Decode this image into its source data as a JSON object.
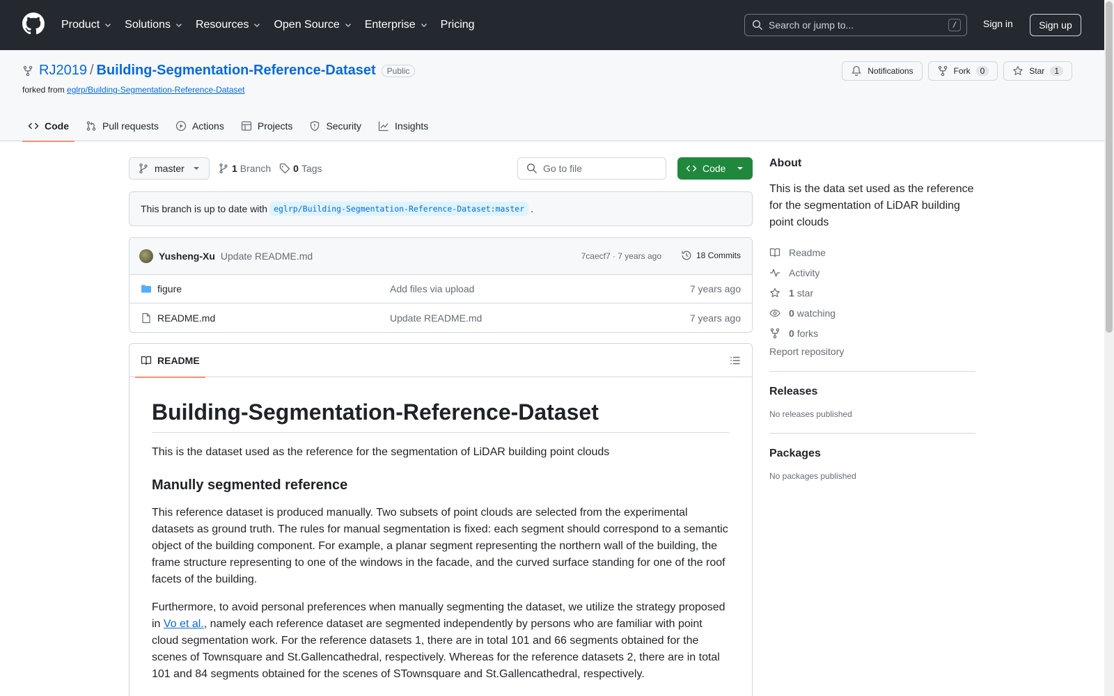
{
  "header": {
    "nav": [
      "Product",
      "Solutions",
      "Resources",
      "Open Source",
      "Enterprise",
      "Pricing"
    ],
    "search_placeholder": "Search or jump to...",
    "search_shortcut": "/",
    "signin": "Sign in",
    "signup": "Sign up"
  },
  "repo": {
    "owner": "RJ2019",
    "separator": "/",
    "name": "Building-Segmentation-Reference-Dataset",
    "visibility": "Public",
    "forked_prefix": "forked from",
    "forked_source": "eglrp/Building-Segmentation-Reference-Dataset",
    "actions": {
      "notifications": "Notifications",
      "fork": "Fork",
      "fork_count": "0",
      "star": "Star",
      "star_count": "1"
    },
    "tabs": [
      "Code",
      "Pull requests",
      "Actions",
      "Projects",
      "Security",
      "Insights"
    ]
  },
  "toolbar": {
    "branch": "master",
    "branch_count": "1",
    "branch_label": "Branch",
    "tag_count": "0",
    "tag_label": "Tags",
    "goto_placeholder": "Go to file",
    "code_label": "Code"
  },
  "uptodate": {
    "text": "This branch is up to date with",
    "ref": "eglrp/Building-Segmentation-Reference-Dataset:master",
    "suffix": "."
  },
  "commit": {
    "author": "Yusheng-Xu",
    "message": "Update README.md",
    "meta": "7caecf7 · 7 years ago",
    "commits": "18 Commits"
  },
  "files": [
    {
      "name": "figure",
      "type": "folder",
      "commit": "Add files via upload",
      "age": "7 years ago"
    },
    {
      "name": "README.md",
      "type": "file",
      "commit": "Update README.md",
      "age": "7 years ago"
    }
  ],
  "readme": {
    "tab": "README",
    "h1": "Building-Segmentation-Reference-Dataset",
    "intro": "This is the dataset used as the reference for the segmentation of LiDAR building point clouds",
    "h2": "Manully segmented reference",
    "p1": "This reference dataset is produced manually. Two subsets of point clouds are selected from the experimental datasets as ground truth. The rules for manual segmentation is fixed: each segment should correspond to a semantic object of the building component. For example, a planar segment representing the northern wall of the building, the frame structure representing to one of the windows in the facade, and the curved surface standing for one of the roof facets of the building.",
    "p2_a": "Furthermore, to avoid personal preferences when manually segmenting the dataset, we utilize the strategy proposed in ",
    "p2_link": "Vo et al.",
    "p2_b": ", namely each reference dataset are segmented independently by persons who are familiar with point cloud segmentation work. For the reference datasets 1, there are in total 101 and 66 segments obtained for the scenes of Townsquare and St.Gallencathedral, respectively. Whereas for the reference datasets 2, there are in total 101 and 84 segments obtained for the scenes of STownsquare and St.Gallencathedral, respectively."
  },
  "sidebar": {
    "about_title": "About",
    "about_desc": "This is the data set used as the reference for the segmentation of LiDAR building point clouds",
    "readme": "Readme",
    "activity": "Activity",
    "stars_count": "1",
    "stars_label": "star",
    "watching_count": "0",
    "watching_label": "watching",
    "forks_count": "0",
    "forks_label": "forks",
    "report": "Report repository",
    "releases_title": "Releases",
    "releases_none": "No releases published",
    "packages_title": "Packages",
    "packages_none": "No packages published"
  },
  "colors": {
    "header_bg": "#24292f",
    "link": "#0969da",
    "code_button": "#1f883d",
    "tab_underline": "#fd8c73"
  }
}
